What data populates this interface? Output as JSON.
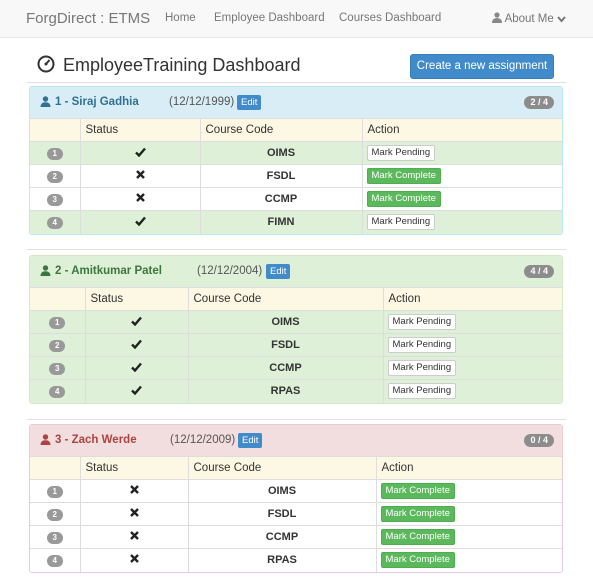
{
  "nav": {
    "brand": "ForgDirect : ETMS",
    "links": [
      "Home",
      "Employee Dashboard",
      "Courses Dashboard"
    ],
    "about": "About Me"
  },
  "header": {
    "title": "EmployeeTraining Dashboard",
    "create_button": "Create a new assignment"
  },
  "table_headers": {
    "status": "Status",
    "course": "Course Code",
    "action": "Action"
  },
  "labels": {
    "edit": "Edit",
    "mark_pending": "Mark Pending",
    "mark_complete": "Mark Complete"
  },
  "employees": [
    {
      "name": "1 - Siraj Gadhia",
      "date": "(12/12/1999)",
      "count": "2 / 4",
      "panel_style": "info",
      "rows": [
        {
          "num": "1",
          "done": true,
          "course": "OIMS",
          "action": "Mark Pending"
        },
        {
          "num": "2",
          "done": false,
          "course": "FSDL",
          "action": "Mark Complete"
        },
        {
          "num": "3",
          "done": false,
          "course": "CCMP",
          "action": "Mark Complete"
        },
        {
          "num": "4",
          "done": true,
          "course": "FIMN",
          "action": "Mark Pending"
        }
      ]
    },
    {
      "name": "2 - Amitkumar Patel",
      "date": "(12/12/2004)",
      "count": "4 / 4",
      "panel_style": "success",
      "rows": [
        {
          "num": "1",
          "done": true,
          "course": "OIMS",
          "action": "Mark Pending"
        },
        {
          "num": "2",
          "done": true,
          "course": "FSDL",
          "action": "Mark Pending"
        },
        {
          "num": "3",
          "done": true,
          "course": "CCMP",
          "action": "Mark Pending"
        },
        {
          "num": "4",
          "done": true,
          "course": "RPAS",
          "action": "Mark Pending"
        }
      ]
    },
    {
      "name": "3 - Zach Werde",
      "date": "(12/12/2009)",
      "count": "0 / 4",
      "panel_style": "danger",
      "rows": [
        {
          "num": "1",
          "done": false,
          "course": "OIMS",
          "action": "Mark Complete"
        },
        {
          "num": "2",
          "done": false,
          "course": "FSDL",
          "action": "Mark Complete"
        },
        {
          "num": "3",
          "done": false,
          "course": "CCMP",
          "action": "Mark Complete"
        },
        {
          "num": "4",
          "done": false,
          "course": "RPAS",
          "action": "Mark Complete"
        }
      ]
    }
  ],
  "colors": {
    "primary": "#428bca",
    "success": "#5cb85c",
    "row_done": "#dff0d8",
    "header_yellow": "#fcf8e3"
  },
  "icons": {
    "status_done": "check-icon",
    "status_pending": "x-icon",
    "employee": "user-icon",
    "dashboard": "dashboard-icon"
  }
}
